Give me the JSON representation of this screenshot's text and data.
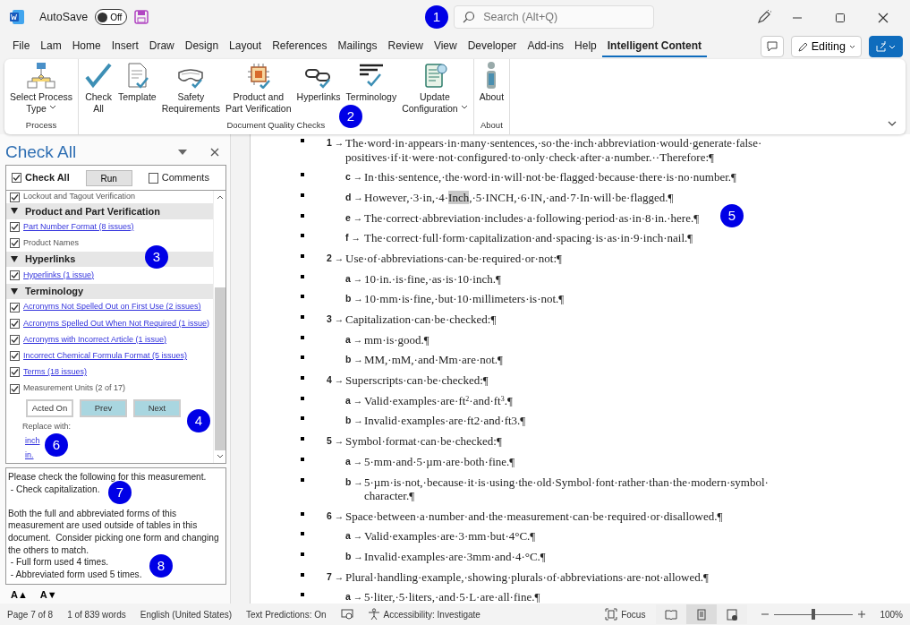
{
  "title_bar": {
    "autosave_label": "AutoSave",
    "autosave": {
      "on": false,
      "label": "Off"
    },
    "search": {
      "placeholder": "Search (Alt+Q)"
    }
  },
  "ribbon_tabs": [
    {
      "label": "File",
      "selected": false
    },
    {
      "label": "Lam",
      "selected": false
    },
    {
      "label": "Home",
      "selected": false
    },
    {
      "label": "Insert",
      "selected": false
    },
    {
      "label": "Draw",
      "selected": false
    },
    {
      "label": "Design",
      "selected": false
    },
    {
      "label": "Layout",
      "selected": false
    },
    {
      "label": "References",
      "selected": false
    },
    {
      "label": "Mailings",
      "selected": false
    },
    {
      "label": "Review",
      "selected": false
    },
    {
      "label": "View",
      "selected": false
    },
    {
      "label": "Developer",
      "selected": false
    },
    {
      "label": "Add-ins",
      "selected": false
    },
    {
      "label": "Help",
      "selected": false
    },
    {
      "label": "Intelligent Content",
      "selected": true
    }
  ],
  "ribbon_actions": {
    "editing": "Editing"
  },
  "ribbon_groups": [
    {
      "label": "Process",
      "buttons": [
        {
          "lines": [
            "Select Process",
            "Type"
          ],
          "dropdown": true
        }
      ]
    },
    {
      "label": "Document Quality Checks",
      "buttons": [
        {
          "lines": [
            "Check",
            "All"
          ],
          "dropdown": false
        },
        {
          "lines": [
            "Template"
          ],
          "dropdown": false
        },
        {
          "lines": [
            "Safety",
            "Requirements"
          ],
          "dropdown": false
        },
        {
          "lines": [
            "Product and",
            "Part Verification"
          ],
          "dropdown": false
        },
        {
          "lines": [
            "Hyperlinks"
          ],
          "dropdown": false
        },
        {
          "lines": [
            "Terminology"
          ],
          "dropdown": false
        },
        {
          "lines": [
            "Update",
            "Configuration"
          ],
          "dropdown": true
        }
      ]
    },
    {
      "label": "About",
      "buttons": [
        {
          "lines": [
            "About"
          ],
          "dropdown": false
        }
      ]
    }
  ],
  "task_pane": {
    "title": "Check All",
    "check_all": {
      "label": "Check All",
      "checked": true
    },
    "run_button": "Run",
    "comments": {
      "label": "Comments",
      "checked": false
    },
    "list": [
      {
        "kind": "item",
        "label": "Lockout and Tagout Verification",
        "checked": true,
        "link": false
      },
      {
        "kind": "section",
        "label": "Product and Part Verification",
        "expanded": true
      },
      {
        "kind": "item",
        "label": "Part Number Format (8 issues)",
        "checked": true,
        "link": true
      },
      {
        "kind": "item",
        "label": "Product Names",
        "checked": true,
        "link": false
      },
      {
        "kind": "section",
        "label": "Hyperlinks",
        "expanded": true
      },
      {
        "kind": "item",
        "label": "Hyperlinks (1 issue)",
        "checked": true,
        "link": true
      },
      {
        "kind": "section",
        "label": "Terminology",
        "expanded": true
      },
      {
        "kind": "item",
        "label": "Acronyms Not Spelled Out on First Use (2 issues)",
        "checked": true,
        "link": true
      },
      {
        "kind": "item",
        "label": "Acronyms Spelled Out When Not Required (1 issue)",
        "checked": true,
        "link": true
      },
      {
        "kind": "item",
        "label": "Acronyms with Incorrect Article (1 issue)",
        "checked": true,
        "link": true
      },
      {
        "kind": "item",
        "label": "Incorrect Chemical Formula Format (5 issues)",
        "checked": true,
        "link": true
      },
      {
        "kind": "item",
        "label": "Terms (18 issues)",
        "checked": true,
        "link": true
      },
      {
        "kind": "item",
        "label": "Measurement Units (2 of 17)",
        "checked": true,
        "link": false
      }
    ],
    "actions": [
      {
        "label": "Acted On",
        "kind": "plain"
      },
      {
        "label": "Prev",
        "kind": "accent"
      },
      {
        "label": "Next",
        "kind": "accent"
      }
    ],
    "replace_label": "Replace with:",
    "replacements": [
      "inch",
      "in."
    ],
    "message": [
      [
        "Please check the following for this measurement.",
        " - Check capitalization."
      ],
      [
        "Both the full and abbreviated forms of this measurement are used outside of tables in this document.  Consider picking one form and changing the others to match.",
        " - Full form used 4 times.",
        " - Abbreviated form used 5 times."
      ]
    ],
    "font_buttons": [
      "A▲",
      "A▼"
    ]
  },
  "document": {
    "items": [
      {
        "label": "1 →",
        "lines": [
          "The·word·in·appears·in·many·sentences,·so·the·inch·abbreviation·would·generate·false·",
          "positives·if·it·were·not·configured·to·only·check·after·a·number.··Therefore:¶"
        ],
        "children": [
          {
            "label": "c →",
            "lines": [
              "In·this·sentence,·the·word·in·will·not·be·flagged·because·there·is·no·number.¶"
            ]
          },
          {
            "label": "d →",
            "lines": [
              "However,·3·in,·4·"
            ],
            "highlighted": "Inch",
            "after": ",·5·INCH,·6·IN,·and·7·In·will·be·flagged.¶"
          },
          {
            "label": "e →",
            "lines": [
              "The·correct·abbreviation·includes·a·following·period·as·in·8·in.·here.¶"
            ]
          },
          {
            "label": "f →",
            "lines": [
              "The·correct·full·form·capitalization·and·spacing·is·as·in·9·inch·nail.¶"
            ]
          }
        ]
      },
      {
        "label": "2 →",
        "lines": [
          "Use·of·abbreviations·can·be·required·or·not:¶"
        ],
        "children": [
          {
            "label": "a →",
            "lines": [
              "10·in.·is·fine,·as·is·10·inch.¶"
            ]
          },
          {
            "label": "b →",
            "lines": [
              "10·mm·is·fine,·but·10·millimeters·is·not.¶"
            ]
          }
        ]
      },
      {
        "label": "3 →",
        "lines": [
          "Capitalization·can·be·checked:¶"
        ],
        "children": [
          {
            "label": "a →",
            "lines": [
              "mm·is·good.¶"
            ]
          },
          {
            "label": "b →",
            "lines": [
              "MM,·mM,·and·Mm·are·not.¶"
            ]
          }
        ]
      },
      {
        "label": "4 →",
        "lines": [
          "Superscripts·can·be·checked:¶"
        ],
        "children": [
          {
            "label": "a →",
            "lines": [
              "Valid·examples·are·ft$^{2}$·and·ft$^{3}$.¶"
            ]
          },
          {
            "label": "b →",
            "lines": [
              "Invalid·examples·are·ft2·and·ft3.¶"
            ]
          }
        ]
      },
      {
        "label": "5 →",
        "lines": [
          "Symbol·format·can·be·checked:¶"
        ],
        "children": [
          {
            "label": "a →",
            "lines": [
              "5·mm·and·5·µm·are·both·fine.¶"
            ]
          },
          {
            "label": "b →",
            "lines": [
              "5·µm·is·not,·because·it·is·using·the·old·Symbol·font·rather·than·the·modern·symbol·",
              "character.¶"
            ]
          }
        ]
      },
      {
        "label": "6 →",
        "lines": [
          "Space·between·a·number·and·the·measurement·can·be·required·or·disallowed.¶"
        ],
        "children": [
          {
            "label": "a →",
            "lines": [
              "Valid·examples·are·3·mm·but·4°C.¶"
            ]
          },
          {
            "label": "b →",
            "lines": [
              "Invalid·examples·are·3mm·and·4·°C.¶"
            ]
          }
        ]
      },
      {
        "label": "7 →",
        "lines": [
          "Plural·handling·example,·showing·plurals·of·abbreviations·are·not·allowed.¶"
        ],
        "children": [
          {
            "label": "a →",
            "lines": [
              "5·liter,·5·liters,·and·5·L·are·all·fine.¶"
            ]
          }
        ]
      }
    ]
  },
  "status_bar": {
    "left": [
      "Page 7 of 8",
      "1 of 839 words",
      "English (United States)",
      "Text Predictions: On"
    ],
    "accessibility": "Accessibility: Investigate",
    "focus": "Focus",
    "views": [
      {
        "selected": false
      },
      {
        "selected": true
      },
      {
        "selected": false
      }
    ],
    "zoom": {
      "level": 0.5,
      "label": "100%"
    }
  },
  "callouts": [
    "1",
    "2",
    "3",
    "4",
    "5",
    "6",
    "7",
    "8"
  ]
}
